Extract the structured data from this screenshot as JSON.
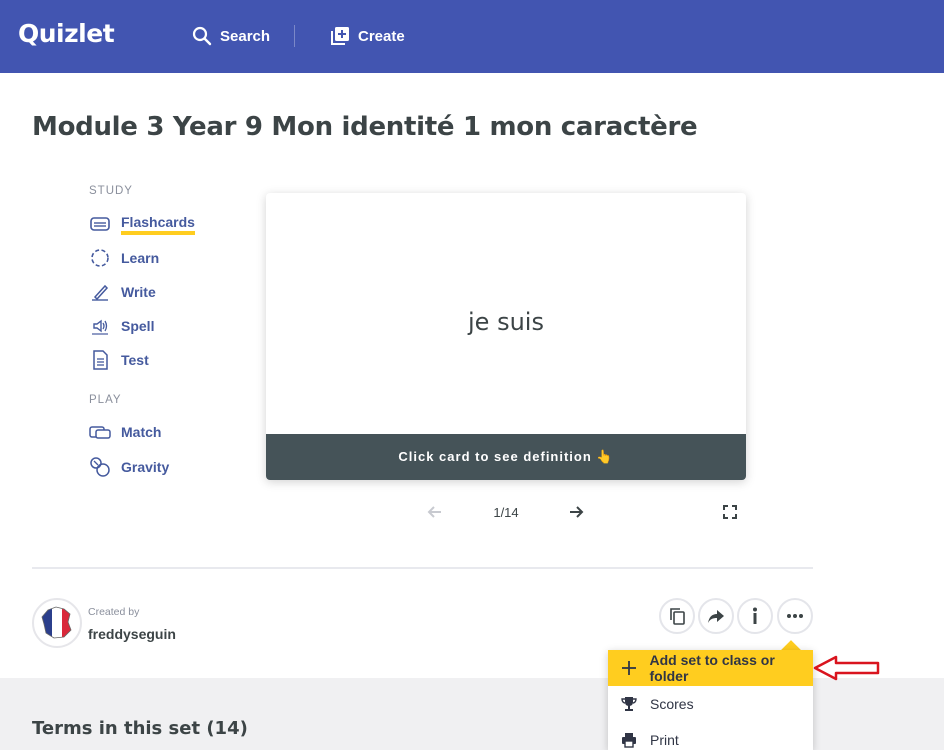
{
  "header": {
    "logo": "Quizlet",
    "search_label": "Search",
    "create_label": "Create"
  },
  "set": {
    "title": "Module 3 Year 9 Mon identité 1 mon caractère"
  },
  "study": {
    "section_label": "STUDY",
    "items": [
      {
        "label": "Flashcards",
        "icon": "flashcards-icon"
      },
      {
        "label": "Learn",
        "icon": "learn-icon"
      },
      {
        "label": "Write",
        "icon": "write-icon"
      },
      {
        "label": "Spell",
        "icon": "spell-icon"
      },
      {
        "label": "Test",
        "icon": "test-icon"
      }
    ]
  },
  "play": {
    "section_label": "PLAY",
    "items": [
      {
        "label": "Match",
        "icon": "match-icon"
      },
      {
        "label": "Gravity",
        "icon": "gravity-icon"
      }
    ]
  },
  "flashcard": {
    "term": "je suis",
    "hint": "Click card to see definition 👆",
    "counter": "1/14"
  },
  "creator": {
    "created_by_label": "Created by",
    "username": "freddyseguin"
  },
  "menu": {
    "items": [
      {
        "label": "Add set to class or folder",
        "icon": "plus-icon"
      },
      {
        "label": "Scores",
        "icon": "trophy-icon"
      },
      {
        "label": "Print",
        "icon": "printer-icon"
      }
    ]
  },
  "terms": {
    "title": "Terms in this set (14)"
  },
  "colors": {
    "header": "#4255b1",
    "accent_yellow": "#ffcd1f",
    "card_footer": "#455358",
    "annotation_red": "#d9141e"
  }
}
